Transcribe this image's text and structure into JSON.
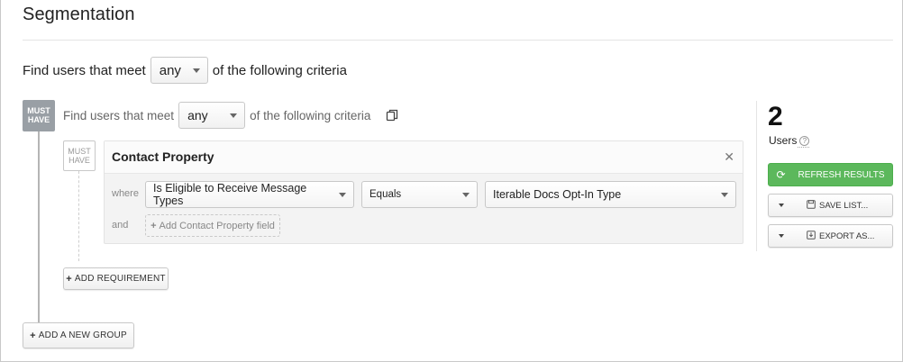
{
  "page": {
    "title": "Segmentation"
  },
  "outer_group": {
    "badge": [
      "MUST",
      "HAVE"
    ],
    "prefix": "Find users that meet",
    "selected": "any",
    "suffix": "of the following criteria"
  },
  "inner_group": {
    "badge": [
      "MUST",
      "HAVE"
    ],
    "prefix": "Find users that meet",
    "selected": "any",
    "suffix": "of the following criteria",
    "copy_icon": "copy-icon",
    "requirement": {
      "badge": [
        "MUST",
        "HAVE"
      ],
      "title": "Contact Property",
      "close_icon": "close-icon",
      "where_label": "where",
      "field": "Is Eligible to Receive Message Types",
      "operator": "Equals",
      "value": "Iterable Docs Opt-In Type",
      "and_label": "and",
      "add_field_label": "Add Contact Property field"
    },
    "add_requirement_label": "ADD REQUIREMENT"
  },
  "add_group_label": "ADD A NEW GROUP",
  "results": {
    "count": "2",
    "users_label": "Users",
    "help_icon": "help-circle-icon",
    "refresh_label": "REFRESH RESULTS",
    "refresh_color": "#5cb85c",
    "save_label": "SAVE LIST...",
    "export_label": "EXPORT AS..."
  }
}
